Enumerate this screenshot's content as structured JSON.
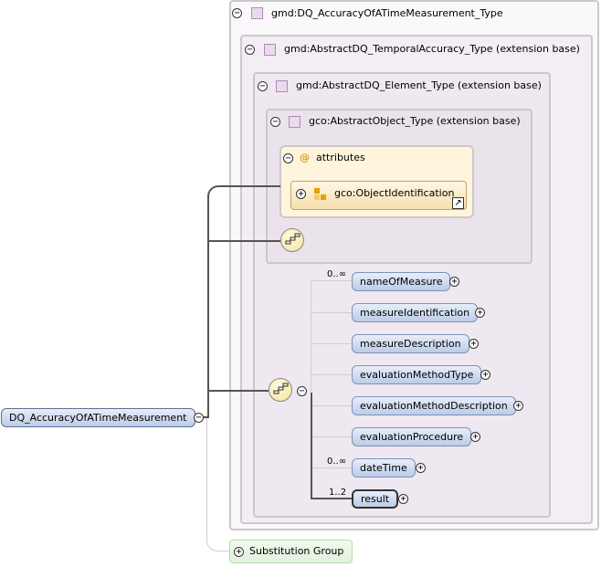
{
  "outer_type": {
    "label": "gmd:DQ_AccuracyOfATimeMeasurement_Type"
  },
  "temporal_type": {
    "label": "gmd:AbstractDQ_TemporalAccuracy_Type (extension base)"
  },
  "element_type": {
    "label": "gmd:AbstractDQ_Element_Type (extension base)"
  },
  "object_type": {
    "label": "gco:AbstractObject_Type (extension base)"
  },
  "attributes": {
    "at_symbol": "@",
    "label": "attributes",
    "group": "gco:ObjectIdentification"
  },
  "root_element": {
    "label": "DQ_AccuracyOfATimeMeasurement"
  },
  "sequence": {
    "items": [
      {
        "label": "nameOfMeasure",
        "occurs": "0..∞"
      },
      {
        "label": "measureIdentification",
        "occurs": ""
      },
      {
        "label": "measureDescription",
        "occurs": ""
      },
      {
        "label": "evaluationMethodType",
        "occurs": ""
      },
      {
        "label": "evaluationMethodDescription",
        "occurs": ""
      },
      {
        "label": "evaluationProcedure",
        "occurs": ""
      },
      {
        "label": "dateTime",
        "occurs": "0..∞"
      },
      {
        "label": "result",
        "occurs": "1..2"
      }
    ]
  },
  "substitution": {
    "label": "Substitution Group"
  },
  "symbols": {
    "minus": "−",
    "plus": "+"
  },
  "icons": [
    "type-square-icon",
    "attribute-group-icon",
    "link-arrow-icon",
    "sequence-icon",
    "expand-icon",
    "collapse-icon"
  ]
}
